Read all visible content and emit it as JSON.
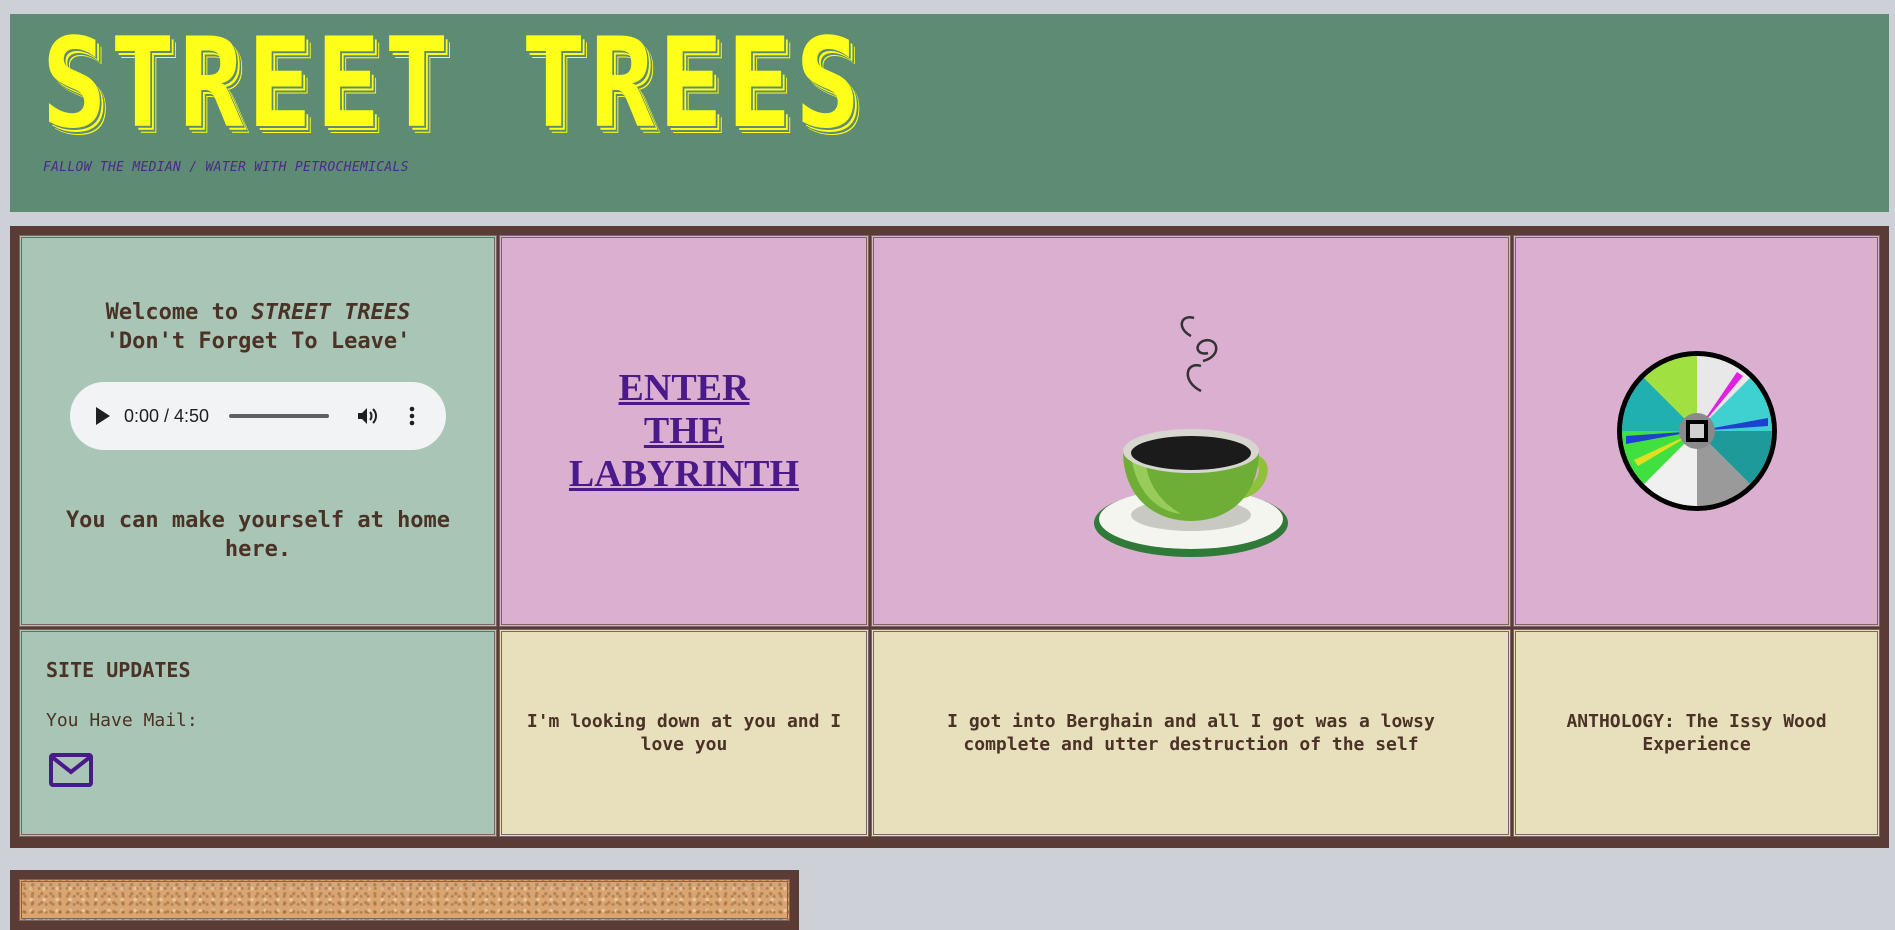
{
  "header": {
    "title": "STREET TREES",
    "tagline": "FALLOW THE MEDIAN / WATER WITH PETROCHEMICALS"
  },
  "welcome": {
    "line1_prefix": "Welcome to ",
    "line1_name": "STREET TREES",
    "line2": "'Don't Forget To Leave'",
    "home_text": "You can make yourself at home here."
  },
  "audio": {
    "time": "0:00 / 4:50"
  },
  "labyrinth": {
    "link_lines": [
      "ENTER",
      "THE",
      "LABYRINTH"
    ]
  },
  "updates": {
    "title": "SITE UPDATES",
    "mail_label": "You Have Mail:"
  },
  "captions": {
    "col2": "I'm looking down at you and I love you",
    "col3": "I got into Berghain and all I got was a lowsy complete and utter destruction of the self",
    "col4": "ANTHOLOGY: The Issy Wood Experience"
  },
  "colors": {
    "header_bg": "#5e8b73",
    "title": "#ffff1a",
    "frame": "#5a3b36",
    "green_cell": "#a8c5b5",
    "pink_cell": "#dbafd0",
    "beige_cell": "#e8dfbc",
    "link": "#4b1a8a"
  },
  "icons": [
    "play-icon",
    "volume-icon",
    "more-options-icon",
    "mail-icon",
    "coffee-cup-image",
    "cd-disc-image"
  ]
}
